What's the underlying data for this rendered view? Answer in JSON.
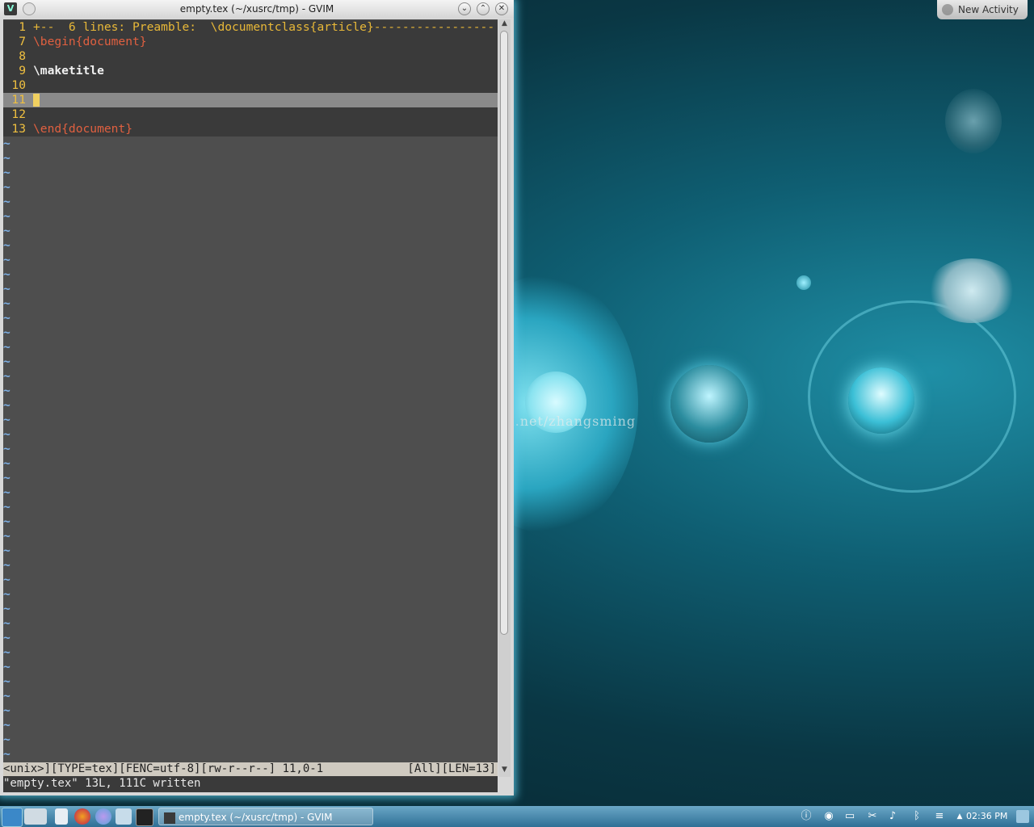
{
  "window": {
    "title": "empty.tex (~/xusrc/tmp) - GVIM",
    "app_icon": "vim-icon"
  },
  "editor": {
    "lines": [
      {
        "num": "1",
        "text": "+--  6 lines: Preamble:  \\documentclass{article}-----------------",
        "type": "fold"
      },
      {
        "num": "7",
        "text": "\\begin{document}",
        "type": "keyword"
      },
      {
        "num": "8",
        "text": "",
        "type": "plain"
      },
      {
        "num": "9",
        "text": "\\maketitle",
        "type": "bold"
      },
      {
        "num": "10",
        "text": "",
        "type": "plain"
      },
      {
        "num": "11",
        "text": "",
        "type": "cursorline"
      },
      {
        "num": "12",
        "text": "",
        "type": "plain"
      },
      {
        "num": "13",
        "text": "\\end{document}",
        "type": "keyword"
      }
    ],
    "tilde": "~"
  },
  "statusline": {
    "left": "<unix>][TYPE=tex][FENC=utf-8][rw-r--r--] 11,0-1",
    "right": "[All][LEN=13]"
  },
  "cmdline": "\"empty.tex\" 13L, 111C written",
  "desktop": {
    "new_activity": "New Activity",
    "watermark": "http://blog.csdn.net/zhangsming"
  },
  "taskbar": {
    "task_label": "empty.tex (~/xusrc/tmp) - GVIM",
    "clock": "02:36 PM"
  },
  "colors": {
    "accent": "#f0c040",
    "keyword": "#e06040",
    "tilde": "#7fb2e8"
  }
}
